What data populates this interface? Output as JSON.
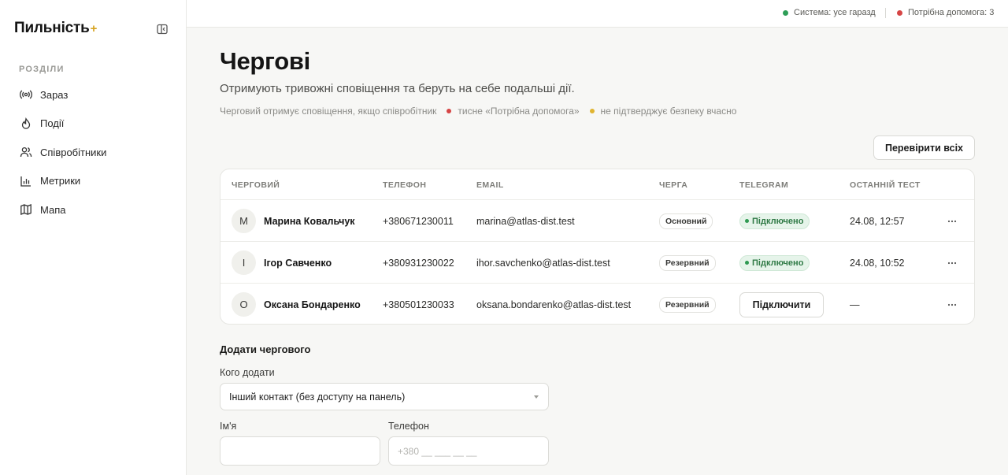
{
  "app": {
    "logo_text": "Пильність",
    "logo_mark": "+"
  },
  "sidebar": {
    "section_label": "РОЗДІЛИ",
    "items": [
      {
        "label": "Зараз",
        "icon": "broadcast-icon"
      },
      {
        "label": "Події",
        "icon": "flame-icon"
      },
      {
        "label": "Співробітники",
        "icon": "users-icon"
      },
      {
        "label": "Метрики",
        "icon": "bar-chart-icon"
      },
      {
        "label": "Мапа",
        "icon": "map-icon"
      }
    ]
  },
  "topbar": {
    "status_ok": "Система: усе гаразд",
    "status_help": "Потрібна допомога: 3",
    "colors": {
      "ok": "#2e9e57",
      "alert": "#d64545"
    }
  },
  "page": {
    "title": "Чергові",
    "subtitle": "Отримують тривожні сповіщення та беруть на себе подальші дії.",
    "hint_1": "Черговий отримує сповіщення, якщо співробітник",
    "hint_2": "тисне «Потрібна допомога»",
    "hint_3": "не підтверджує безпеку вчасно",
    "hint_colors": {
      "red": "#d64545",
      "yellow": "#e0b430"
    },
    "check_all_button": "Перевірити всіх"
  },
  "table": {
    "headers": {
      "person": "ЧЕРГОВИЙ",
      "phone": "ТЕЛЕФОН",
      "email": "EMAIL",
      "queue": "ЧЕРГА",
      "telegram": "TELEGRAM",
      "last_test": "ОСТАННІЙ ТЕСТ"
    },
    "rows": [
      {
        "initial": "М",
        "name": "Марина Ковальчук",
        "phone": "+380671230011",
        "email": "marina@atlas-dist.test",
        "queue": "Основний",
        "telegram": "Підключено",
        "last_test": "24.08, 12:57"
      },
      {
        "initial": "І",
        "name": "Ігор Савченко",
        "phone": "+380931230022",
        "email": "ihor.savchenko@atlas-dist.test",
        "queue": "Резервний",
        "telegram": "Підключено",
        "last_test": "24.08, 10:52"
      },
      {
        "initial": "О",
        "name": "Оксана Бондаренко",
        "phone": "+380501230033",
        "email": "oksana.bondarenko@atlas-dist.test",
        "queue": "Резервний",
        "telegram_button": "Підключити",
        "last_test": "—"
      }
    ]
  },
  "form": {
    "title": "Додати чергового",
    "who_label": "Кого додати",
    "who_value": "Інший контакт (без доступу на панель)",
    "name_label": "Ім'я",
    "name_value": "",
    "phone_label": "Телефон",
    "phone_placeholder": "+380 __ ___ __ __"
  }
}
